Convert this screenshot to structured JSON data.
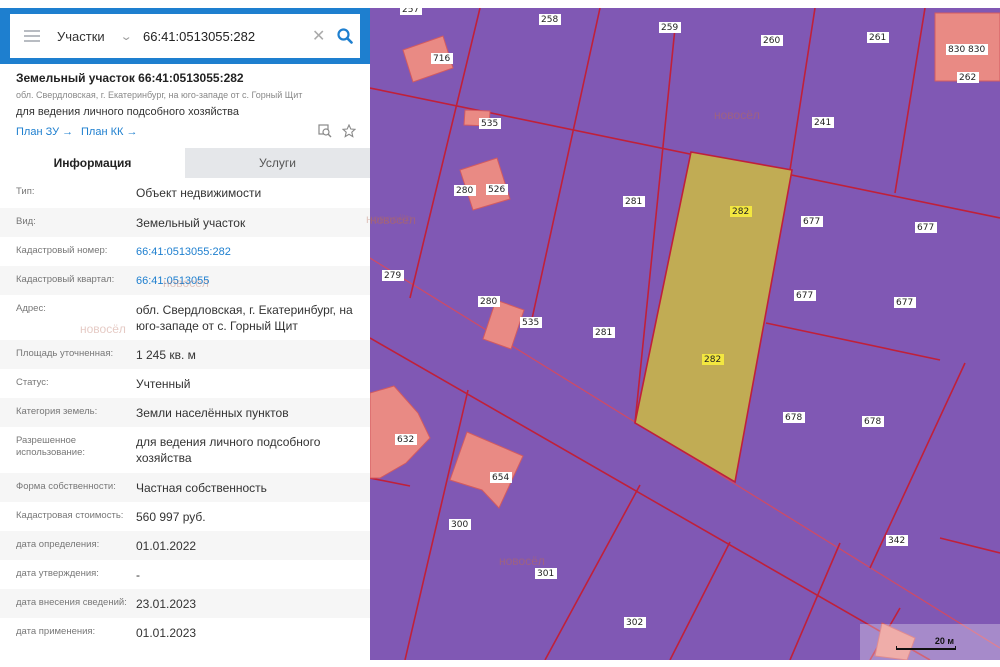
{
  "search": {
    "layer": "Участки",
    "query": "66:41:0513055:282"
  },
  "card": {
    "title": "Земельный участок 66:41:0513055:282",
    "address_short": "обл. Свердловская, г. Екатеринбург, на юго-западе от с. Горный Щит",
    "purpose": "для ведения личного подсобного хозяйства",
    "plan_zu": "План ЗУ →",
    "plan_kk": "План КК →"
  },
  "tabs": [
    "Информация",
    "Услуги"
  ],
  "rows": [
    {
      "label": "Тип:",
      "value": "Объект недвижимости"
    },
    {
      "label": "Вид:",
      "value": "Земельный участок"
    },
    {
      "label": "Кадастровый номер:",
      "value": "66:41:0513055:282",
      "link": true
    },
    {
      "label": "Кадастровый квартал:",
      "value": "66:41:0513055",
      "link": true
    },
    {
      "label": "Адрес:",
      "value": "обл. Свердловская, г. Екатеринбург, на юго-западе от с. Горный Щит"
    },
    {
      "label": "Площадь уточненная:",
      "value": "1 245 кв. м"
    },
    {
      "label": "Статус:",
      "value": "Учтенный"
    },
    {
      "label": "Категория земель:",
      "value": "Земли населённых пунктов"
    },
    {
      "label": "Разрешенное использование:",
      "value": "для ведения личного подсобного хозяйства"
    },
    {
      "label": "Форма собственности:",
      "value": "Частная собственность"
    },
    {
      "label": "Кадастровая стоимость:",
      "value": "560 997 руб."
    },
    {
      "label": "дата определения:",
      "value": "01.01.2022"
    },
    {
      "label": "дата утверждения:",
      "value": "-"
    },
    {
      "label": "дата внесения сведений:",
      "value": "23.01.2023"
    },
    {
      "label": "дата применения:",
      "value": "01.01.2023"
    }
  ],
  "map": {
    "parcel_labels": [
      "257",
      "258",
      "259",
      "260",
      "261",
      "262",
      "830",
      "830",
      "716",
      "535",
      "280",
      "526",
      "281",
      "282",
      "282",
      "677",
      "677",
      "677",
      "677",
      "279",
      "280",
      "535",
      "281",
      "678",
      "678",
      "632",
      "654",
      "300",
      "301",
      "302",
      "342",
      "241"
    ],
    "watermark": "новосёл",
    "scale": "20 м",
    "colors": {
      "parcel": "#8058b4",
      "border": "#c0203a",
      "building": "#e98a84",
      "selected": "#c1ac54"
    }
  }
}
